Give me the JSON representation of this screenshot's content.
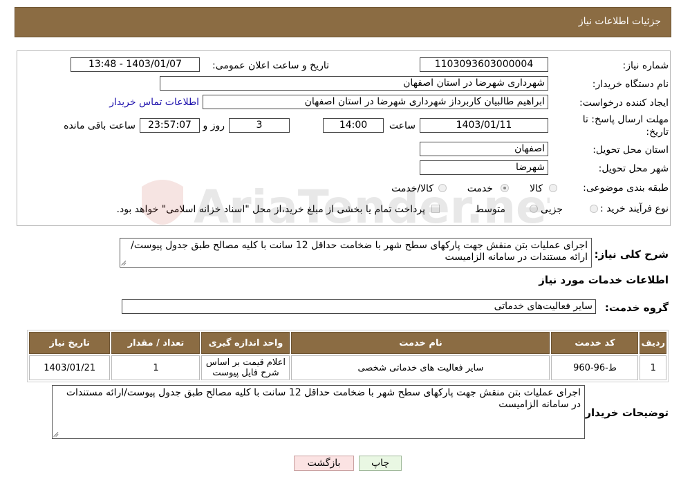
{
  "header": {
    "title": "جزئیات اطلاعات نیاز"
  },
  "form": {
    "need_number_label": "شماره نیاز:",
    "need_number": "1103093603000004",
    "announce_label": "تاریخ و ساعت اعلان عمومی:",
    "announce_value": "1403/01/07 - 13:48",
    "buyer_org_label": "نام دستگاه خریدار:",
    "buyer_org": "شهرداری شهرضا در استان اصفهان",
    "requester_label": "ایجاد کننده درخواست:",
    "requester": "ابراهیم طالبیان کاربرداز شهرداری شهرضا در استان اصفهان",
    "buyer_contact_link": "اطلاعات تماس خریدار",
    "deadline_label_1": "مهلت ارسال پاسخ: تا",
    "deadline_label_2": "تاریخ:",
    "deadline_date": "1403/01/11",
    "time_label": "ساعت",
    "deadline_time": "14:00",
    "days_value": "3",
    "days_label": "روز و",
    "remaining_time": "23:57:07",
    "remaining_label": "ساعت باقی مانده",
    "province_label": "استان محل تحویل:",
    "province": "اصفهان",
    "city_label": "شهر محل تحویل:",
    "city": "شهرضا",
    "category_label": "طبقه بندی موضوعی:",
    "category_options": [
      {
        "label": "کالا",
        "selected": false
      },
      {
        "label": "خدمت",
        "selected": true
      },
      {
        "label": "کالا/خدمت",
        "selected": false
      }
    ],
    "process_label": "نوع فرآیند خرید :",
    "process_options": [
      {
        "label": "جزیی",
        "selected": false
      },
      {
        "label": "متوسط",
        "selected": false
      }
    ],
    "payment_note": "پرداخت تمام یا بخشی از مبلغ خرید،از محل \"اسناد خزانه اسلامی\" خواهد بود."
  },
  "summary": {
    "label": "شرح کلی نیاز:",
    "text": "اجرای عملیات بتن منقش جهت پارکهای سطح شهر با ضخامت حداقل 12 سانت با کلیه مصالح طبق جدول پیوست/ارائه مستندات در سامانه الزامیست"
  },
  "services": {
    "section_title": "اطلاعات خدمات مورد نیاز",
    "group_label": "گروه خدمت:",
    "group_value": "سایر فعالیت‌های خدماتی",
    "columns": [
      "ردیف",
      "کد خدمت",
      "نام خدمت",
      "واحد اندازه گیری",
      "تعداد / مقدار",
      "تاریخ نیاز"
    ],
    "rows": [
      {
        "row": "1",
        "code": "ط-96-960",
        "name": "سایر فعالیت های خدماتی شخصی",
        "unit": "اعلام قیمت بر اساس شرح فایل پیوست",
        "qty": "1",
        "date": "1403/01/21"
      }
    ]
  },
  "buyer_notes": {
    "label": "توضیحات خریدار:",
    "text": "اجرای عملیات بتن منقش جهت پارکهای سطح شهر با ضخامت حداقل 12 سانت با کلیه مصالح طبق جدول پیوست/ارائه مستندات در سامانه الزامیست"
  },
  "buttons": {
    "print": "چاپ",
    "back": "بازگشت"
  },
  "watermark": {
    "text": "AriaTender.net"
  },
  "colors": {
    "header_bg": "#8b6c43",
    "print_bg": "#e9f7e3",
    "back_bg": "#fbe3e3",
    "link": "#1a0dab"
  }
}
